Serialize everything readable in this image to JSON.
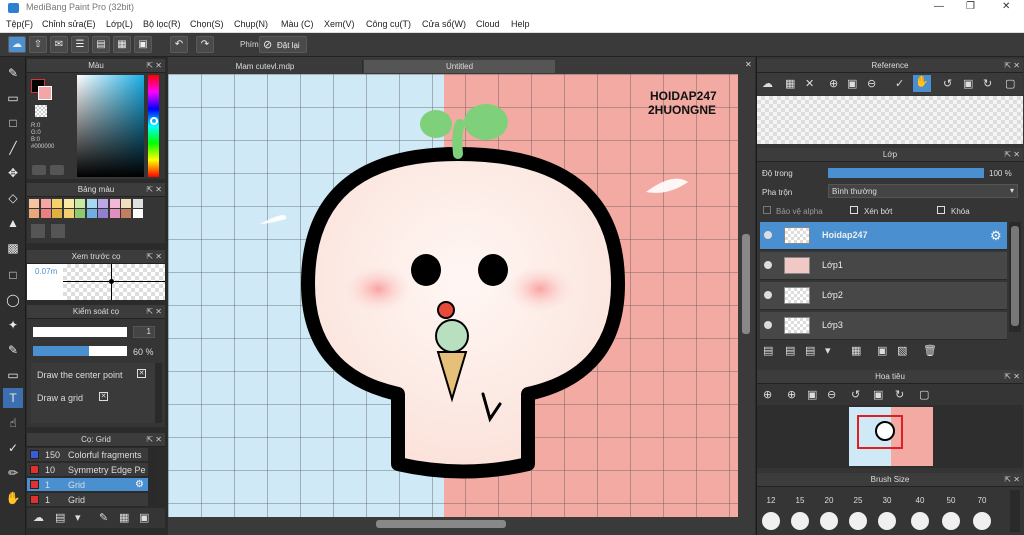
{
  "window": {
    "title": "MediBang Paint Pro (32bit)"
  },
  "menu": [
    "Tệp(F)",
    "Chỉnh sửa(E)",
    "Lớp(L)",
    "Bộ lọc(R)",
    "Chọn(S)",
    "Chụp(N)",
    "Màu (C)",
    "Xem(V)",
    "Công cụ(T)",
    "Cửa sổ(W)",
    "Cloud",
    "Help"
  ],
  "toolbar": {
    "shortcut_label": "Phím",
    "reset_label": "Đặt lại"
  },
  "color_panel": {
    "title": "Màu",
    "r": "R:0",
    "g": "G:0",
    "b": "B:0",
    "hex": "#000000"
  },
  "palette_panel": {
    "title": "Bảng màu"
  },
  "brush_preview_panel": {
    "title": "Xem trước cọ",
    "size": "0.07m"
  },
  "brush_control_panel": {
    "title": "Kiểm soát cọ",
    "size_value": "1",
    "opacity_value": "60 %",
    "opacity_fraction": 0.6,
    "options": [
      "Draw the center point",
      "Draw a grid"
    ]
  },
  "brush_list_panel": {
    "title": "Cọ: Grid",
    "items": [
      {
        "size": "150",
        "name": "Colorful fragments",
        "color": "#3a5bd8"
      },
      {
        "size": "10",
        "name": "Symmetry Edge Pe",
        "color": "#e03030"
      },
      {
        "size": "1",
        "name": "Grid",
        "color": "#e03030"
      },
      {
        "size": "1",
        "name": "Grid",
        "color": "#e03030"
      }
    ]
  },
  "tabs": {
    "file1": "Mam cutevl.mdp",
    "file2": "Untitled"
  },
  "artwork": {
    "watermark_line1": "HOIDAP247",
    "watermark_line2": "2HUONGNE"
  },
  "reference_panel": {
    "title": "Reference"
  },
  "layer_panel": {
    "title": "Lớp",
    "opacity_label": "Độ trong",
    "opacity_value": "100 %",
    "opacity_fraction": 1.0,
    "blend_label": "Pha trộn",
    "blend_value": "Bình thường",
    "protect_alpha": "Bảo vệ alpha",
    "clipping": "Xén bớt",
    "lock": "Khóa",
    "layers": [
      "Hoidap247",
      "Lớp1",
      "Lớp2",
      "Lớp3"
    ]
  },
  "navigator_panel": {
    "title": "Hoa tiêu"
  },
  "brush_size_panel": {
    "title": "Brush Size",
    "sizes": [
      "12",
      "15",
      "20",
      "25",
      "30",
      "40",
      "50",
      "70"
    ]
  },
  "colors": {
    "accent": "#4a90d0",
    "canvas_blue": "#cfe9f6",
    "canvas_pink": "#f2aaa3",
    "sprout": "#7ed07a"
  }
}
